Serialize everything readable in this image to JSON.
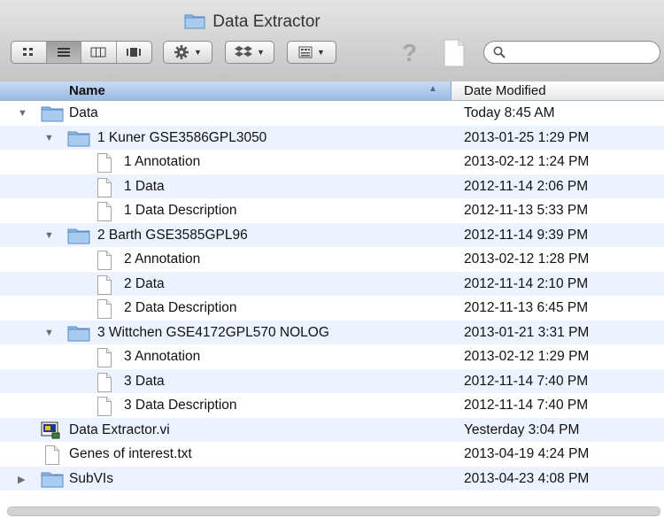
{
  "window": {
    "title": "Data Extractor"
  },
  "toolbar": {
    "view_modes": [
      "icon-view",
      "list-view",
      "column-view",
      "coverflow-view"
    ],
    "active_view": 1,
    "action_icon": "gear-icon",
    "dropbox_icon": "dropbox-icon",
    "arrange_icon": "arrange-icon",
    "help_label": "?",
    "search_placeholder": ""
  },
  "columns": {
    "name": "Name",
    "date": "Date Modified"
  },
  "rows": [
    {
      "name": "Data",
      "date": "Today 8:45 AM",
      "level": 0,
      "type": "folder",
      "expanded": true
    },
    {
      "name": "1 Kuner GSE3586GPL3050",
      "date": "2013-01-25 1:29 PM",
      "level": 1,
      "type": "folder",
      "expanded": true
    },
    {
      "name": "1 Annotation",
      "date": "2013-02-12 1:24 PM",
      "level": 2,
      "type": "file"
    },
    {
      "name": "1 Data",
      "date": "2012-11-14 2:06 PM",
      "level": 2,
      "type": "file"
    },
    {
      "name": "1 Data Description",
      "date": "2012-11-13 5:33 PM",
      "level": 2,
      "type": "file"
    },
    {
      "name": "2 Barth GSE3585GPL96",
      "date": "2012-11-14 9:39 PM",
      "level": 1,
      "type": "folder",
      "expanded": true
    },
    {
      "name": "2 Annotation",
      "date": "2013-02-12 1:28 PM",
      "level": 2,
      "type": "file"
    },
    {
      "name": "2 Data",
      "date": "2012-11-14 2:10 PM",
      "level": 2,
      "type": "file"
    },
    {
      "name": "2 Data Description",
      "date": "2012-11-13 6:45 PM",
      "level": 2,
      "type": "file"
    },
    {
      "name": "3 Wittchen GSE4172GPL570 NOLOG",
      "date": "2013-01-21 3:31 PM",
      "level": 1,
      "type": "folder",
      "expanded": true
    },
    {
      "name": "3 Annotation",
      "date": "2013-02-12 1:29 PM",
      "level": 2,
      "type": "file"
    },
    {
      "name": "3 Data",
      "date": "2012-11-14 7:40 PM",
      "level": 2,
      "type": "file"
    },
    {
      "name": "3 Data Description",
      "date": "2012-11-14 7:40 PM",
      "level": 2,
      "type": "file"
    },
    {
      "name": "Data Extractor.vi",
      "date": "Yesterday 3:04 PM",
      "level": 0,
      "type": "vi"
    },
    {
      "name": "Genes of interest.txt",
      "date": "2013-04-19 4:24 PM",
      "level": 0,
      "type": "file"
    },
    {
      "name": "SubVIs",
      "date": "2013-04-23 4:08 PM",
      "level": 0,
      "type": "folder",
      "expanded": false
    }
  ]
}
